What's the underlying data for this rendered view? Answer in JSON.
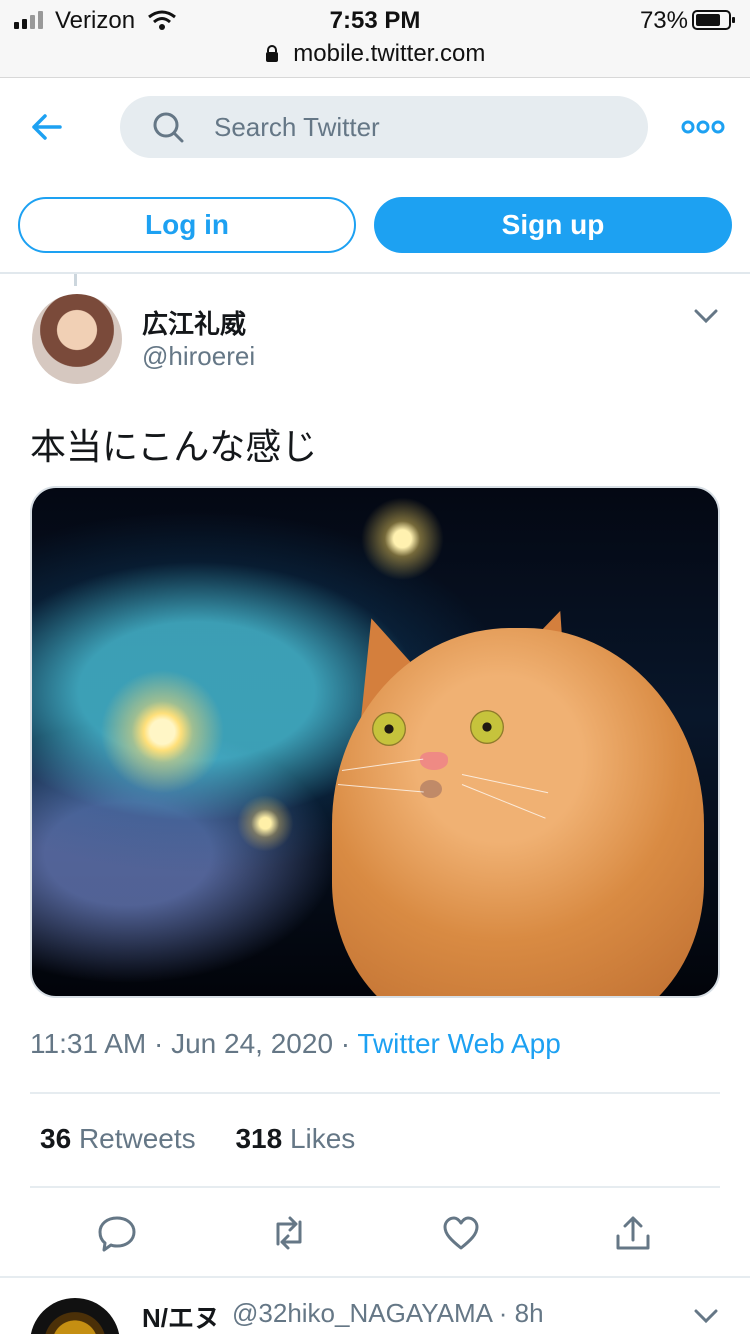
{
  "status_bar": {
    "carrier": "Verizon",
    "time": "7:53 PM",
    "battery": "73%",
    "url": "mobile.twitter.com"
  },
  "header": {
    "search_placeholder": "Search Twitter"
  },
  "auth": {
    "login_label": "Log in",
    "signup_label": "Sign up"
  },
  "tweet": {
    "display_name": "広江礼威",
    "handle": "@hiroerei",
    "text": "本当にこんな感じ",
    "timestamp": "11:31 AM · Jun 24, 2020 · ",
    "source": "Twitter Web App",
    "retweets_count": "36",
    "retweets_label": "Retweets",
    "likes_count": "318",
    "likes_label": "Likes"
  },
  "next_tweet": {
    "display_name": "N/エヌ",
    "handle_time": "@32hiko_NAGAYAMA · 8h"
  },
  "colors": {
    "accent": "#1da1f2",
    "muted": "#657786",
    "search_bg": "#e6ecf0"
  },
  "icons": {
    "back": "arrow-left-icon",
    "search": "search-icon",
    "more": "more-icon",
    "reply": "reply-icon",
    "retweet": "retweet-icon",
    "like": "heart-icon",
    "share": "share-icon"
  }
}
